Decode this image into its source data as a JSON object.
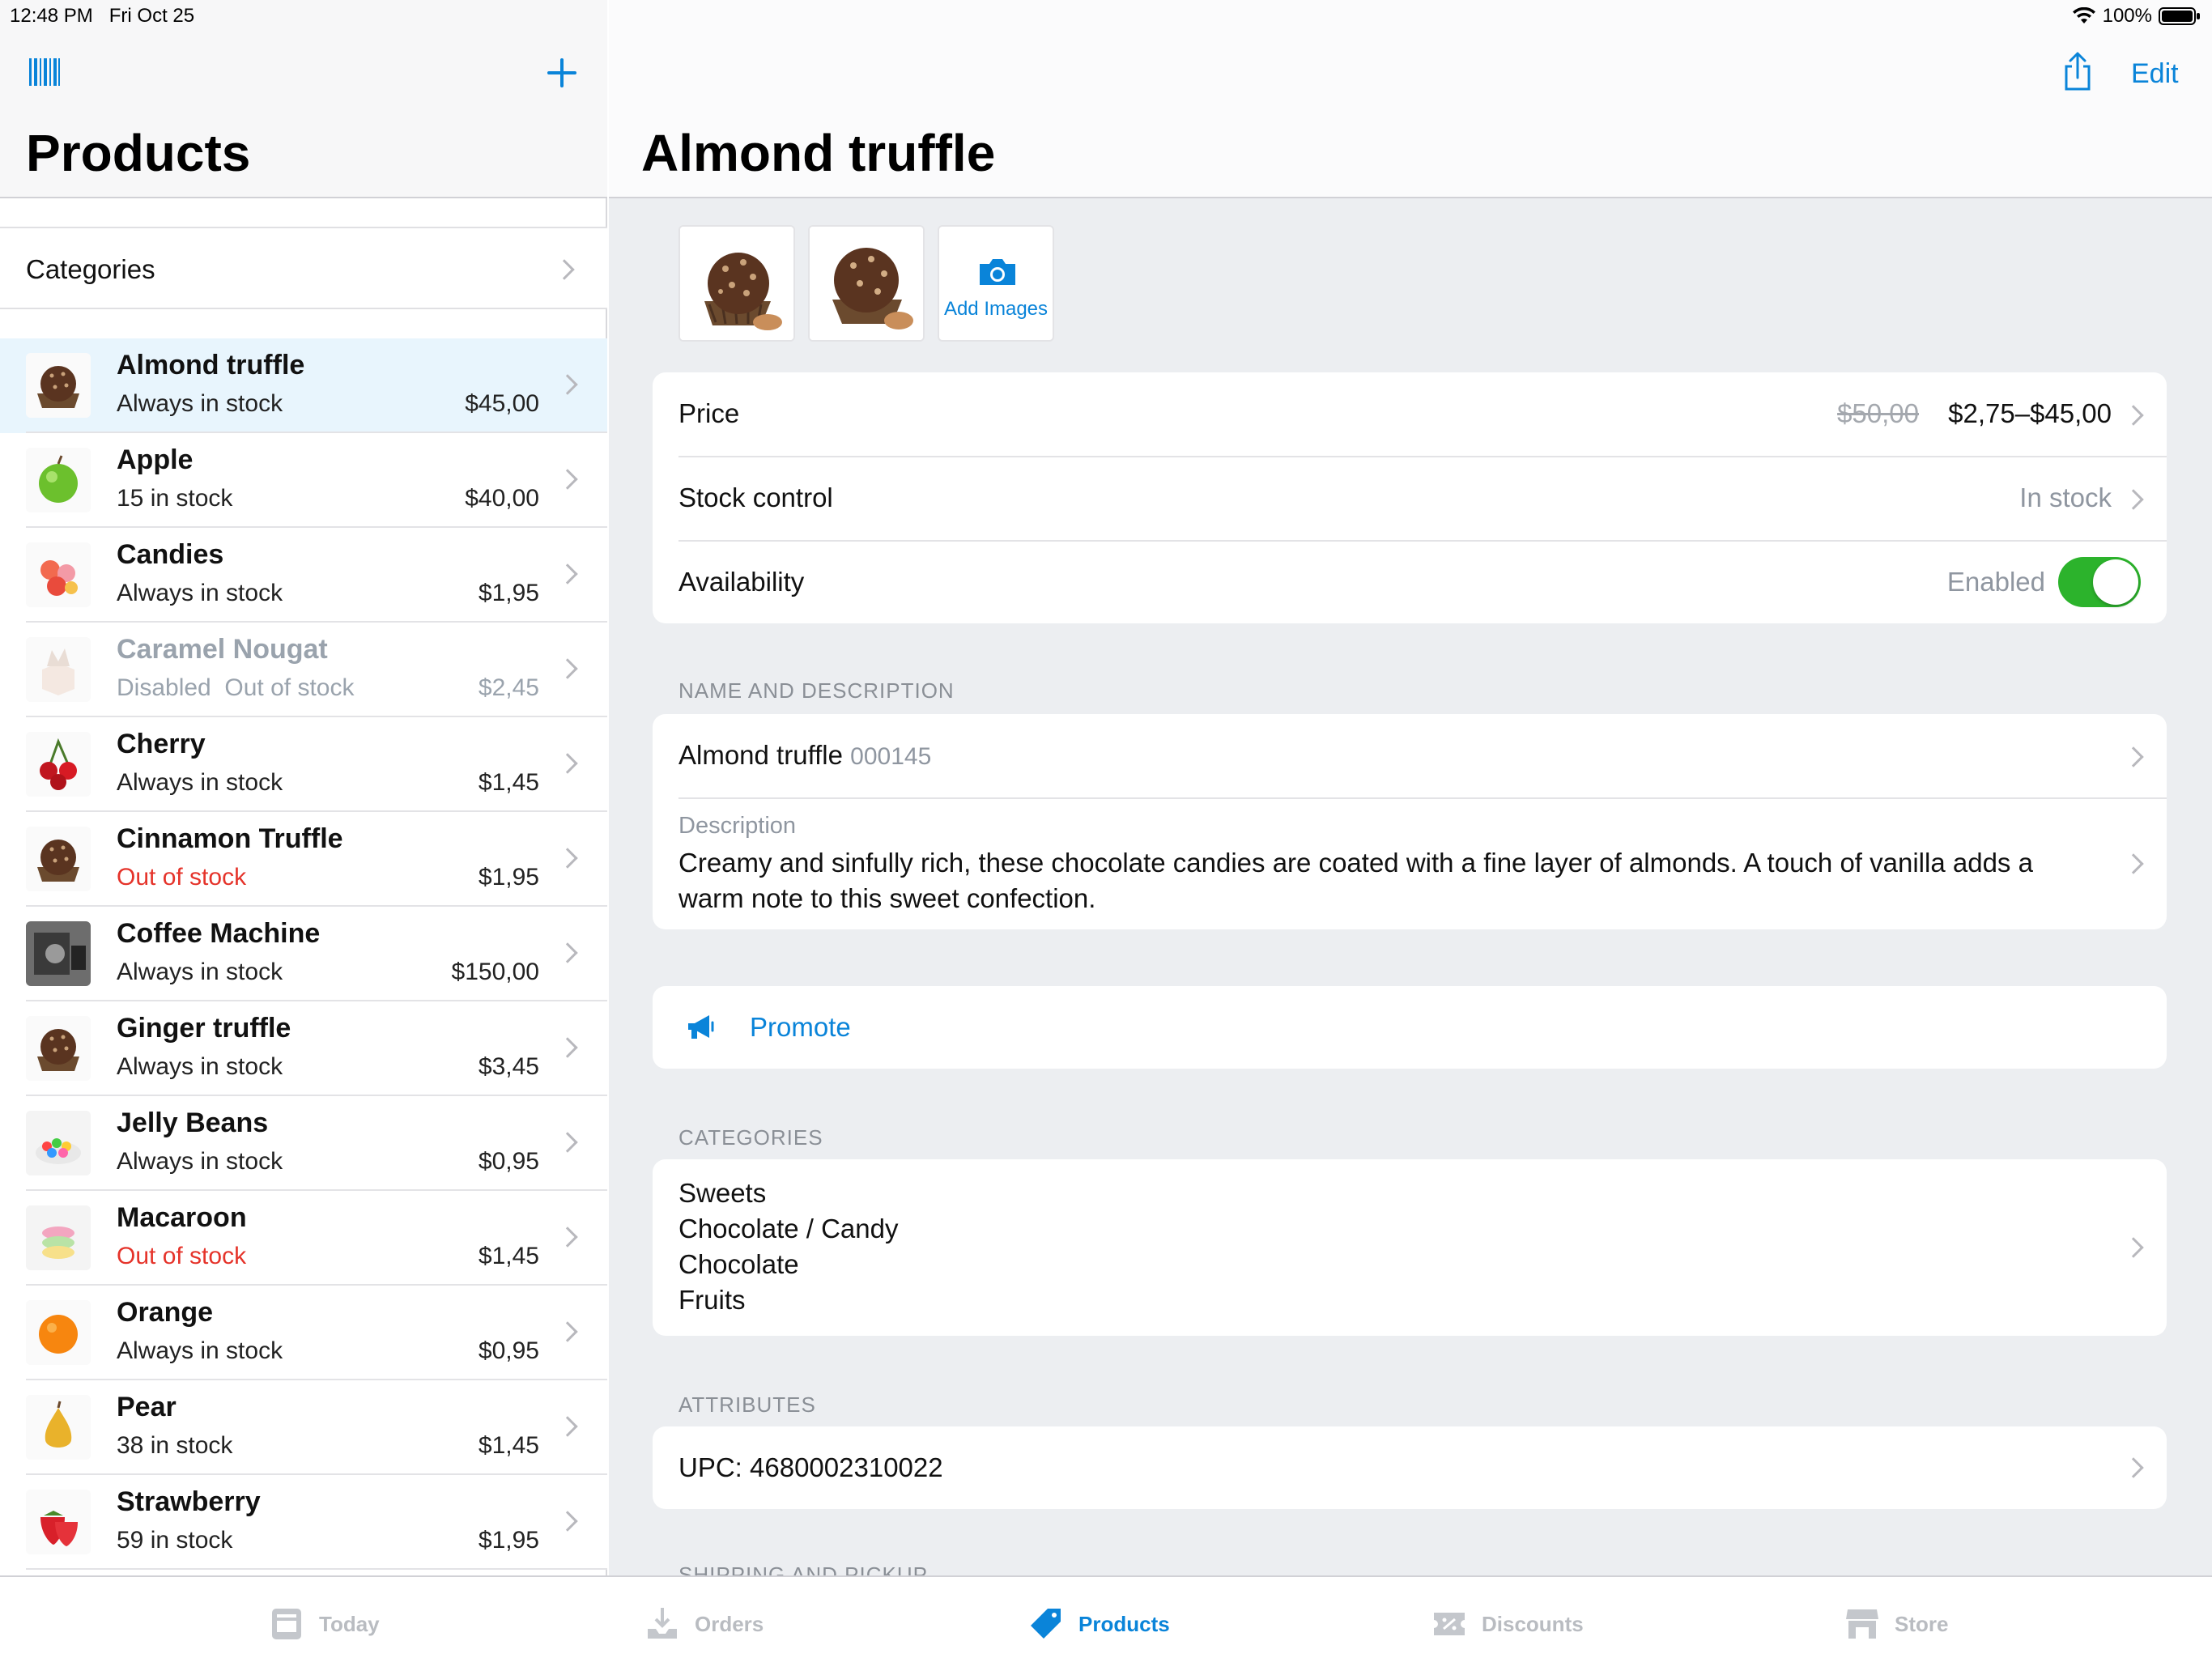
{
  "status_bar": {
    "time": "12:48 PM",
    "date": "Fri Oct 25",
    "battery": "100%"
  },
  "master": {
    "title": "Products",
    "categories_label": "Categories",
    "products": [
      {
        "name": "Almond truffle",
        "status": "",
        "stock": "Always in stock",
        "price": "$45,00",
        "thumb": "truffle",
        "selected": true,
        "disabled": false,
        "stock_red": false
      },
      {
        "name": "Apple",
        "status": "",
        "stock": "15 in stock",
        "price": "$40,00",
        "thumb": "apple",
        "selected": false,
        "disabled": false,
        "stock_red": false
      },
      {
        "name": "Candies",
        "status": "",
        "stock": "Always in stock",
        "price": "$1,95",
        "thumb": "candies",
        "selected": false,
        "disabled": false,
        "stock_red": false
      },
      {
        "name": "Caramel Nougat",
        "status": "Disabled",
        "stock": "Out of stock",
        "price": "$2,45",
        "thumb": "nougat",
        "selected": false,
        "disabled": true,
        "stock_red": false
      },
      {
        "name": "Cherry",
        "status": "",
        "stock": "Always in stock",
        "price": "$1,45",
        "thumb": "cherry",
        "selected": false,
        "disabled": false,
        "stock_red": false
      },
      {
        "name": "Cinnamon Truffle",
        "status": "",
        "stock": "Out of stock",
        "price": "$1,95",
        "thumb": "truffle",
        "selected": false,
        "disabled": false,
        "stock_red": true
      },
      {
        "name": "Coffee Machine",
        "status": "",
        "stock": "Always in stock",
        "price": "$150,00",
        "thumb": "coffee",
        "selected": false,
        "disabled": false,
        "stock_red": false
      },
      {
        "name": "Ginger truffle",
        "status": "",
        "stock": "Always in stock",
        "price": "$3,45",
        "thumb": "truffle",
        "selected": false,
        "disabled": false,
        "stock_red": false
      },
      {
        "name": "Jelly Beans",
        "status": "",
        "stock": "Always in stock",
        "price": "$0,95",
        "thumb": "jelly",
        "selected": false,
        "disabled": false,
        "stock_red": false
      },
      {
        "name": "Macaroon",
        "status": "",
        "stock": "Out of stock",
        "price": "$1,45",
        "thumb": "macaroon",
        "selected": false,
        "disabled": false,
        "stock_red": true
      },
      {
        "name": "Orange",
        "status": "",
        "stock": "Always in stock",
        "price": "$0,95",
        "thumb": "orange",
        "selected": false,
        "disabled": false,
        "stock_red": false
      },
      {
        "name": "Pear",
        "status": "",
        "stock": "38 in stock",
        "price": "$1,45",
        "thumb": "pear",
        "selected": false,
        "disabled": false,
        "stock_red": false
      },
      {
        "name": "Strawberry",
        "status": "",
        "stock": "59 in stock",
        "price": "$1,95",
        "thumb": "strawberry",
        "selected": false,
        "disabled": false,
        "stock_red": false
      }
    ]
  },
  "detail": {
    "edit_label": "Edit",
    "title": "Almond truffle",
    "add_images_label": "Add Images",
    "price_label": "Price",
    "old_price": "$50,00",
    "price_range": "$2,75–$45,00",
    "stock_label": "Stock control",
    "stock_value": "In stock",
    "availability_label": "Availability",
    "availability_value": "Enabled",
    "availability_on": true,
    "name_section": "NAME AND DESCRIPTION",
    "product_name": "Almond truffle",
    "sku": "000145",
    "description_label": "Description",
    "description": "Creamy and sinfully rich, these chocolate candies are coated with a fine layer of almonds. A touch of vanilla adds a warm note to this sweet confection.",
    "promote_label": "Promote",
    "categories_section": "CATEGORIES",
    "categories": [
      "Sweets",
      "Chocolate / Candy",
      "Chocolate",
      "Fruits"
    ],
    "attributes_section": "ATTRIBUTES",
    "upc": "UPC: 4680002310022",
    "shipping_section": "SHIPPING AND PICKUP"
  },
  "tabbar": {
    "tabs": [
      {
        "label": "Today",
        "icon": "today-icon",
        "active": false
      },
      {
        "label": "Orders",
        "icon": "orders-icon",
        "active": false
      },
      {
        "label": "Products",
        "icon": "products-tag-icon",
        "active": true
      },
      {
        "label": "Discounts",
        "icon": "discounts-icon",
        "active": false
      },
      {
        "label": "Store",
        "icon": "store-icon",
        "active": false
      }
    ]
  },
  "colors": {
    "accent": "#0a84d9",
    "toggle_on": "#2cb32c",
    "out_of_stock": "#e5332a"
  }
}
